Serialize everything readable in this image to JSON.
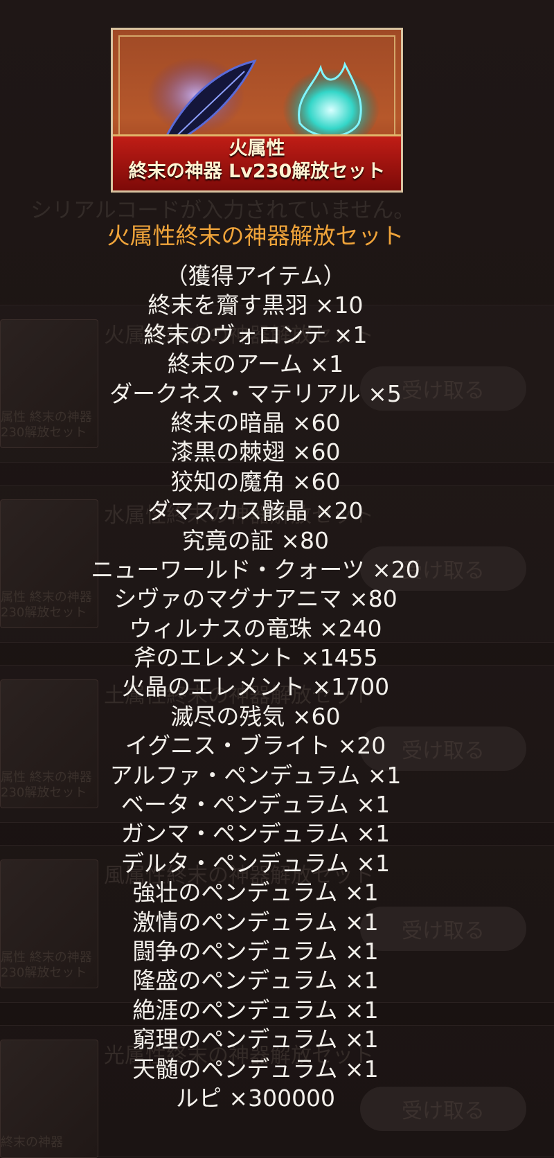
{
  "background": {
    "serial_message": "シリアルコードが入力されていません。",
    "rows": [
      {
        "thumb_caption": "属性 終末の神器\n230解放セット",
        "title": "火属性終末の神器解放セット",
        "button": "受け取る"
      },
      {
        "thumb_caption": "属性 終末の神器\n230解放セット",
        "title": "水属性終末の神器解放セット",
        "button": "受け取る"
      },
      {
        "thumb_caption": "属性 終末の神器\n230解放セット",
        "title": "土属性終末の神器解放セット",
        "button": "受け取る"
      },
      {
        "thumb_caption": "属性 終末の神器\n230解放セット",
        "title": "風属性終末の神器解放セット",
        "button": "受け取る"
      },
      {
        "thumb_caption": "終末の神器",
        "title": "光属性終末の神器解放セット",
        "button": "受け取る"
      }
    ]
  },
  "banner": {
    "line1": "火属性",
    "line2": "終末の神器 Lv230解放セット"
  },
  "popup": {
    "title": "火属性終末の神器解放セット",
    "items": [
      "（獲得アイテム）",
      "終末を齎す黒羽 ×10",
      "終末のヴォロンテ ×1",
      "終末のアーム ×1",
      "ダークネス・マテリアル ×5",
      "終末の暗晶 ×60",
      "漆黒の棘翅 ×60",
      "狡知の魔角 ×60",
      "ダマスカス骸晶 ×20",
      "究竟の証 ×80",
      "ニューワールド・クォーツ ×20",
      "シヴァのマグナアニマ ×80",
      "ウィルナスの竜珠 ×240",
      "斧のエレメント ×1455",
      "火晶のエレメント ×1700",
      "滅尽の残気 ×60",
      "イグニス・ブライト ×20",
      "アルファ・ペンデュラム ×1",
      "ベータ・ペンデュラム ×1",
      "ガンマ・ペンデュラム ×1",
      "デルタ・ペンデュラム ×1",
      "強壮のペンデュラム ×1",
      "激情のペンデュラム ×1",
      "闘争のペンデュラム ×1",
      "隆盛のペンデュラム ×1",
      "絶涯のペンデュラム ×1",
      "窮理のペンデュラム ×1",
      "天髄のペンデュラム ×1",
      "ルピ ×300000"
    ]
  }
}
